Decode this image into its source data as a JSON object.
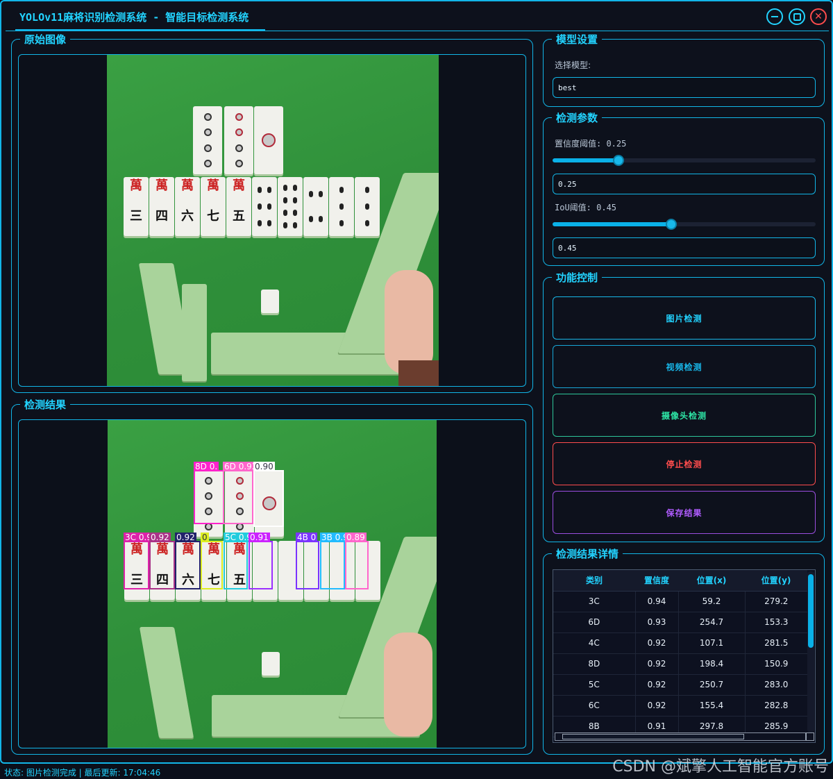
{
  "window": {
    "title": "YOLOv11麻将识别检测系统 - 智能目标检测系统"
  },
  "panels": {
    "original_title": "原始图像",
    "result_title": "检测结果"
  },
  "detections_overlay": [
    {
      "label": "8D 0."
    },
    {
      "label": "6D 0.93"
    },
    {
      "label": "0.90"
    },
    {
      "label": "3C 0.94"
    },
    {
      "label": "0.92"
    },
    {
      "label": "0.92"
    },
    {
      "label": "0"
    },
    {
      "label": "5C 0.92"
    },
    {
      "label": "0.91"
    },
    {
      "label": "4B 0"
    },
    {
      "label": "3B 0.90"
    },
    {
      "label": "0.89"
    }
  ],
  "model_settings": {
    "title": "模型设置",
    "select_label": "选择模型:",
    "model_value": "best"
  },
  "detect_params": {
    "title": "检测参数",
    "conf_label": "置信度阈值: 0.25",
    "conf_value": 0.25,
    "conf_text": "0.25",
    "iou_label": "IoU阈值: 0.45",
    "iou_value": 0.45,
    "iou_text": "0.45"
  },
  "controls": {
    "title": "功能控制",
    "image_detect": "图片检测",
    "video_detect": "视频检测",
    "camera_detect": "摄像头检测",
    "stop_detect": "停止检测",
    "save_result": "保存结果"
  },
  "results_table": {
    "title": "检测结果详情",
    "headers": [
      "类别",
      "置信度",
      "位置(x)",
      "位置(y)"
    ],
    "rows": [
      [
        "3C",
        "0.94",
        "59.2",
        "279.2"
      ],
      [
        "6D",
        "0.93",
        "254.7",
        "153.3"
      ],
      [
        "4C",
        "0.92",
        "107.1",
        "281.5"
      ],
      [
        "8D",
        "0.92",
        "198.4",
        "150.9"
      ],
      [
        "5C",
        "0.92",
        "250.7",
        "283.0"
      ],
      [
        "6C",
        "0.92",
        "155.4",
        "282.8"
      ],
      [
        "8B",
        "0.91",
        "297.8",
        "285.9"
      ]
    ]
  },
  "status": {
    "text": "状态: 图片检测完成 | 最后更新: 17:04:46"
  },
  "watermark": "CSDN @斌擎人工智能官方账号",
  "colors": {
    "accent": "#22d3ff",
    "border": "#12b6e8",
    "stop": "#ff4d4d",
    "save": "#b05cff",
    "camera": "#2ee6a6",
    "video": "#18b8ea"
  }
}
